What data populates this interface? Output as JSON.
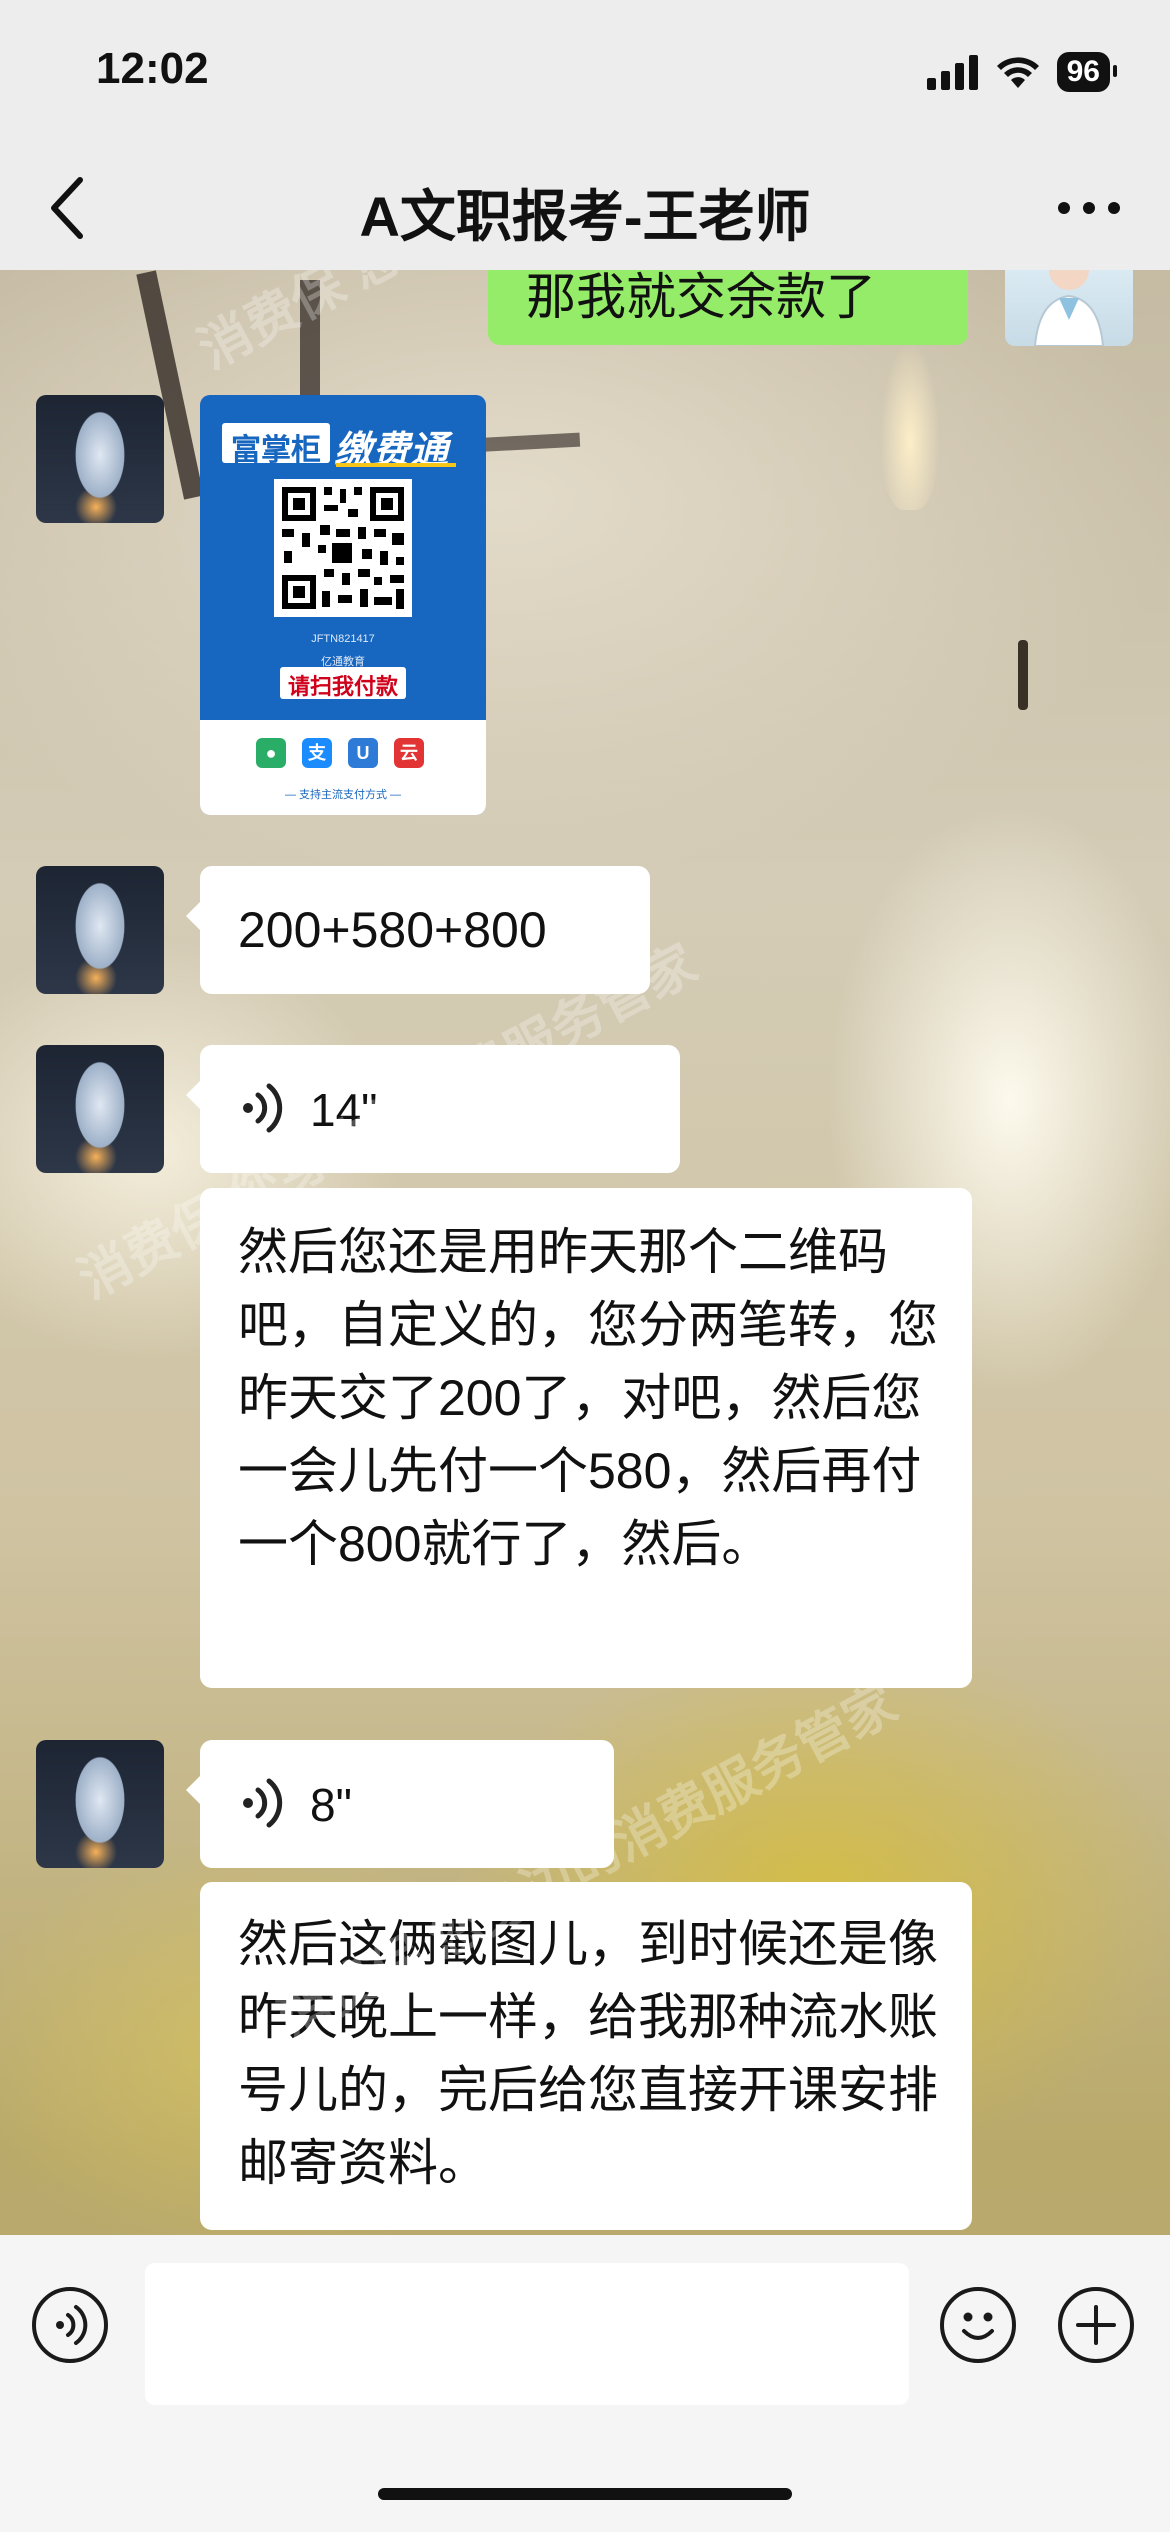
{
  "status_bar": {
    "time": "12:02",
    "battery": "96"
  },
  "nav": {
    "title": "A文职报考-王老师"
  },
  "messages": {
    "sent_partial": "那我就交余款了",
    "qr_card": {
      "brand": "富掌柜",
      "service": "缴费通",
      "ref": "JFTN821417",
      "org": "亿通教育",
      "cta": "请扫我付款",
      "pay_icons": [
        "wechat-pay",
        "alipay",
        "union-pay",
        "cloud-pay"
      ],
      "support": "— 支持主流支付方式 —"
    },
    "amount_text": "200+580+800",
    "voice1": {
      "duration": "14\"",
      "transcript": "然后您还是用昨天那个二维码吧，自定义的，您分两笔转，您昨天交了200了，对吧，然后您一会儿先付一个580，然后再付一个800就行了，然后。"
    },
    "voice2": {
      "duration": "8\"",
      "transcript": "然后这俩截图儿，到时候还是像昨天晚上一样，给我那种流水账号儿的，完后给您直接开课安排邮寄资料。"
    }
  },
  "input": {
    "placeholder": ""
  },
  "watermark": [
    "消费保 您身边的消费服务管家"
  ],
  "colors": {
    "sent_bubble": "#95ec69",
    "received_bubble": "#ffffff",
    "nav_bg": "#ededed",
    "qr_blue": "#1766bf",
    "cta_red": "#d0021b"
  }
}
